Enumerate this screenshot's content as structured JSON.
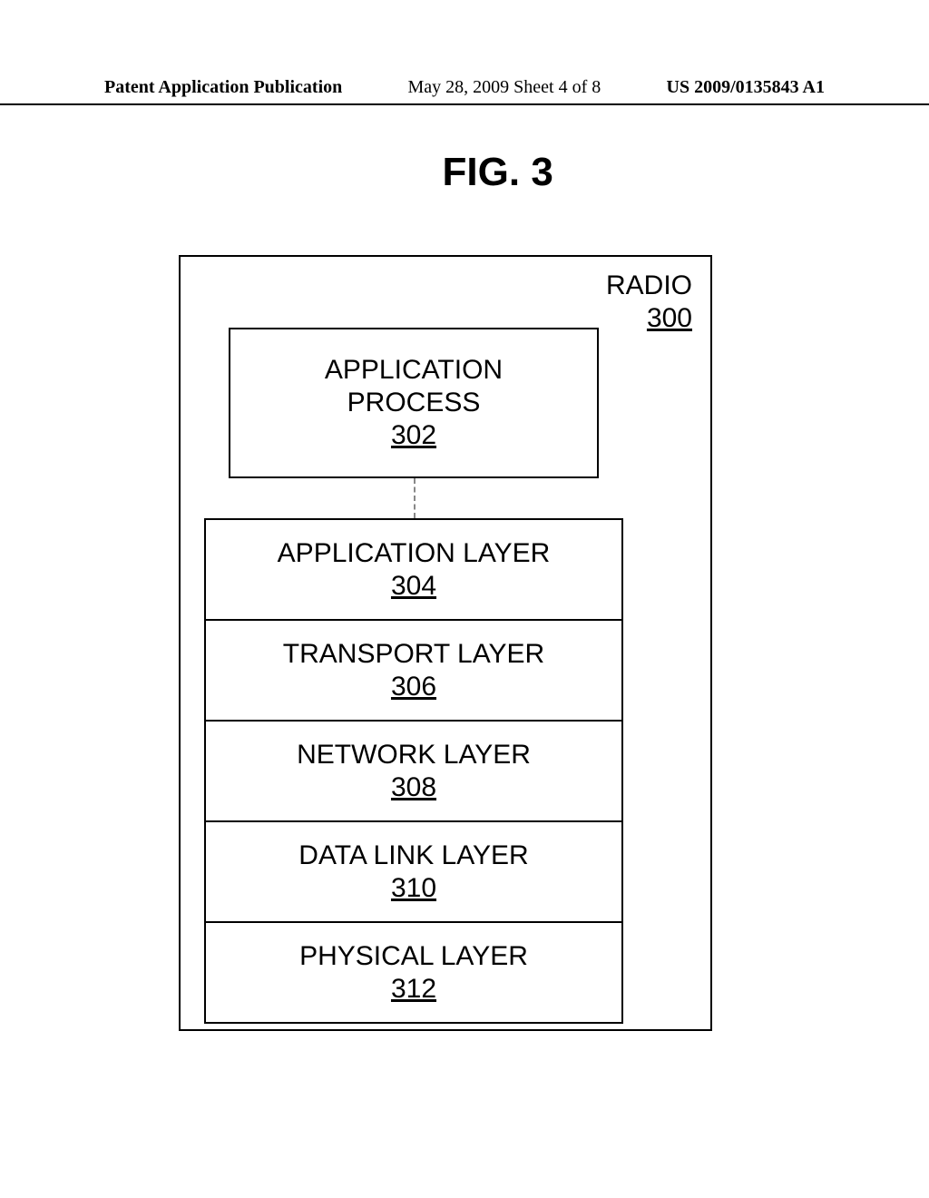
{
  "header": {
    "left": "Patent Application Publication",
    "center": "May 28, 2009  Sheet 4 of 8",
    "right": "US 2009/0135843 A1"
  },
  "figure_title": "FIG. 3",
  "radio": {
    "label": "RADIO",
    "num": "300"
  },
  "app_process": {
    "line1": "APPLICATION",
    "line2": "PROCESS",
    "num": "302"
  },
  "layers": [
    {
      "label": "APPLICATION LAYER",
      "num": "304"
    },
    {
      "label": "TRANSPORT LAYER",
      "num": "306"
    },
    {
      "label": "NETWORK LAYER",
      "num": "308"
    },
    {
      "label": "DATA LINK LAYER",
      "num": "310"
    },
    {
      "label": "PHYSICAL LAYER",
      "num": "312"
    }
  ]
}
